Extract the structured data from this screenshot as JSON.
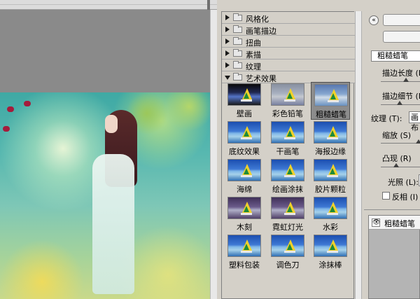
{
  "gallery": {
    "categories": [
      {
        "label": "风格化",
        "expanded": false
      },
      {
        "label": "画笔描边",
        "expanded": false
      },
      {
        "label": "扭曲",
        "expanded": false
      },
      {
        "label": "素描",
        "expanded": false
      },
      {
        "label": "纹理",
        "expanded": false
      },
      {
        "label": "艺术效果",
        "expanded": true
      }
    ],
    "thumbnails": [
      {
        "label": "壁画",
        "style": "dark",
        "selected": false
      },
      {
        "label": "彩色铅笔",
        "style": "gray",
        "selected": false
      },
      {
        "label": "粗糙蜡笔",
        "style": "pale",
        "selected": true
      },
      {
        "label": "底纹效果",
        "style": "normal",
        "selected": false
      },
      {
        "label": "干画笔",
        "style": "normal",
        "selected": false
      },
      {
        "label": "海报边缘",
        "style": "normal",
        "selected": false
      },
      {
        "label": "海绵",
        "style": "normal",
        "selected": false
      },
      {
        "label": "绘画涂抹",
        "style": "normal",
        "selected": false
      },
      {
        "label": "胶片颗粒",
        "style": "normal",
        "selected": false
      },
      {
        "label": "木刻",
        "style": "purple",
        "selected": false
      },
      {
        "label": "霓虹灯光",
        "style": "purple",
        "selected": false
      },
      {
        "label": "水彩",
        "style": "normal",
        "selected": false
      },
      {
        "label": "塑料包装",
        "style": "normal",
        "selected": false
      },
      {
        "label": "调色刀",
        "style": "normal",
        "selected": false
      },
      {
        "label": "涂抹棒",
        "style": "normal",
        "selected": false
      }
    ]
  },
  "settings": {
    "collapse_glyph": "«",
    "selected_filter": "粗糙蜡笔",
    "stroke_length_label": "描边长度 (L)",
    "stroke_detail_label": "描边细节 (D)",
    "texture_label": "纹理 (T):",
    "texture_value": "画布",
    "scaling_label": "缩放 (S)",
    "relief_label": "凸现 (R)",
    "light_label": "光照 (L):",
    "invert_label": "反相 (I)"
  },
  "layers": {
    "eye_glyph": "👁",
    "active_layer": "粗糙蜡笔"
  }
}
